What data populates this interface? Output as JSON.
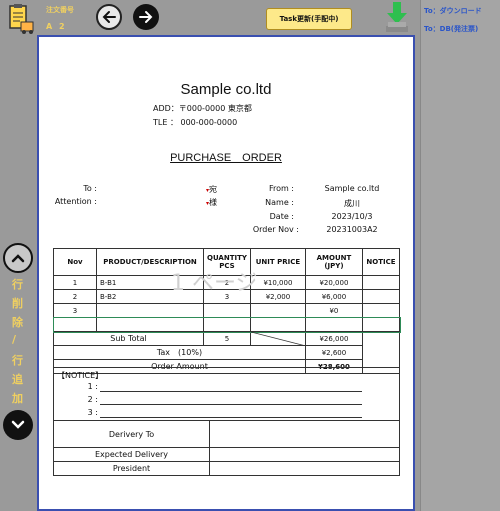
{
  "toolbar": {
    "order_label": "注文番号",
    "order_value": "A 2",
    "back_icon": "arrow-left-icon",
    "forward_icon": "arrow-right-icon",
    "task_button": "Task更新(手配中)"
  },
  "side_links": {
    "download": "To：ダウンロード",
    "db": "To：DB(発注票)"
  },
  "row_controls": {
    "chars": [
      "行",
      "削",
      "除",
      "/",
      "行",
      "追",
      "加"
    ]
  },
  "doc": {
    "company": "Sample co.ltd",
    "add": "ADD：〒000-0000 東京都",
    "tle": "TLE ： 000-000-0000",
    "title": "PURCHASE　ORDER",
    "to_label": "To :",
    "attention_label": "Attention :",
    "to_suffix": "宛",
    "attention_suffix": "様",
    "from_label": "From :",
    "from_value": "Sample co.ltd",
    "name_label": "Name :",
    "name_value": "成川",
    "date_label": "Date :",
    "date_value": "2023/10/3",
    "orderno_label": "Order Nov :",
    "orderno_value": "20231003A2",
    "watermark": "1 ページ",
    "headers": [
      "Nov",
      "PRODUCT/DESCRIPTION",
      "QUANTITY PCS",
      "UNIT PRICE",
      "AMOUNT (JPY)",
      "NOTICE"
    ],
    "rows": [
      {
        "no": "1",
        "product": "B-B1",
        "qty": "2",
        "unit": "¥10,000",
        "amount": "¥20,000",
        "notice": ""
      },
      {
        "no": "2",
        "product": "B-B2",
        "qty": "3",
        "unit": "¥2,000",
        "amount": "¥6,000",
        "notice": ""
      },
      {
        "no": "3",
        "product": "",
        "qty": "",
        "unit": "",
        "amount": "¥0",
        "notice": ""
      }
    ],
    "subtotal_label": "Sub Total",
    "subtotal_qty": "5",
    "subtotal_amount": "¥26,000",
    "tax_label": "Tax　(10%)",
    "tax_amount": "¥2,600",
    "order_amount_label": "Order Amount",
    "order_amount": "¥28,600",
    "notice_label": "【NOTICE】",
    "notice_lines": [
      "1 :",
      "2 :",
      "3 :"
    ],
    "delivery_to": "Derivery To",
    "expected_delivery": "Expected Delivery",
    "president": "President"
  }
}
